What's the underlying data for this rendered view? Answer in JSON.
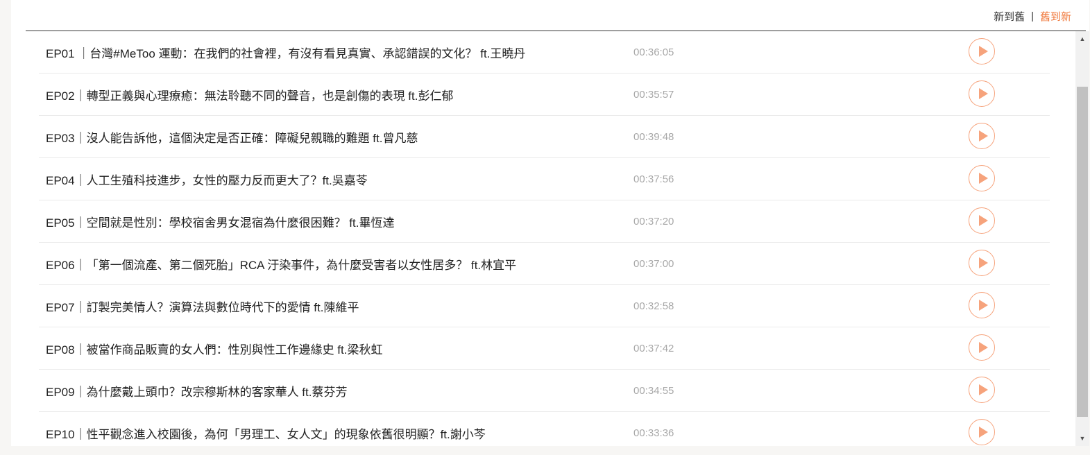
{
  "sort": {
    "new_to_old": "新到舊",
    "separator": "|",
    "old_to_new": "舊到新"
  },
  "colors": {
    "accent": "#f0773a",
    "play_border": "#f6a37c",
    "duration": "#a8a8a8"
  },
  "episodes": [
    {
      "title": "EP01 ｜台灣#MeToo 運動：在我們的社會裡，有沒有看見真實、承認錯誤的文化？ ft.王曉丹",
      "duration": "00:36:05"
    },
    {
      "title": "EP02｜轉型正義與心理療癒：無法聆聽不同的聲音，也是創傷的表現 ft.彭仁郁",
      "duration": "00:35:57"
    },
    {
      "title": "EP03｜沒人能告訴他，這個決定是否正確：障礙兒親職的難題 ft.曾凡慈",
      "duration": "00:39:48"
    },
    {
      "title": "EP04｜人工生殖科技進步，女性的壓力反而更大了？ft.吳嘉苓",
      "duration": "00:37:56"
    },
    {
      "title": "EP05｜空間就是性別：學校宿舍男女混宿為什麼很困難？ ft.畢恆達",
      "duration": "00:37:20"
    },
    {
      "title": "EP06｜「第一個流產、第二個死胎」RCA 汙染事件，為什麼受害者以女性居多？ ft.林宜平",
      "duration": "00:37:00"
    },
    {
      "title": "EP07｜訂製完美情人？演算法與數位時代下的愛情 ft.陳維平",
      "duration": "00:32:58"
    },
    {
      "title": "EP08｜被當作商品販賣的女人們：性別與性工作邊緣史 ft.梁秋虹",
      "duration": "00:37:42"
    },
    {
      "title": "EP09｜為什麼戴上頭巾？改宗穆斯林的客家華人 ft.蔡芬芳",
      "duration": "00:34:55"
    },
    {
      "title": "EP10｜性平觀念進入校園後，為何「男理工、女人文」的現象依舊很明顯？ft.謝小芩",
      "duration": "00:33:36"
    }
  ]
}
